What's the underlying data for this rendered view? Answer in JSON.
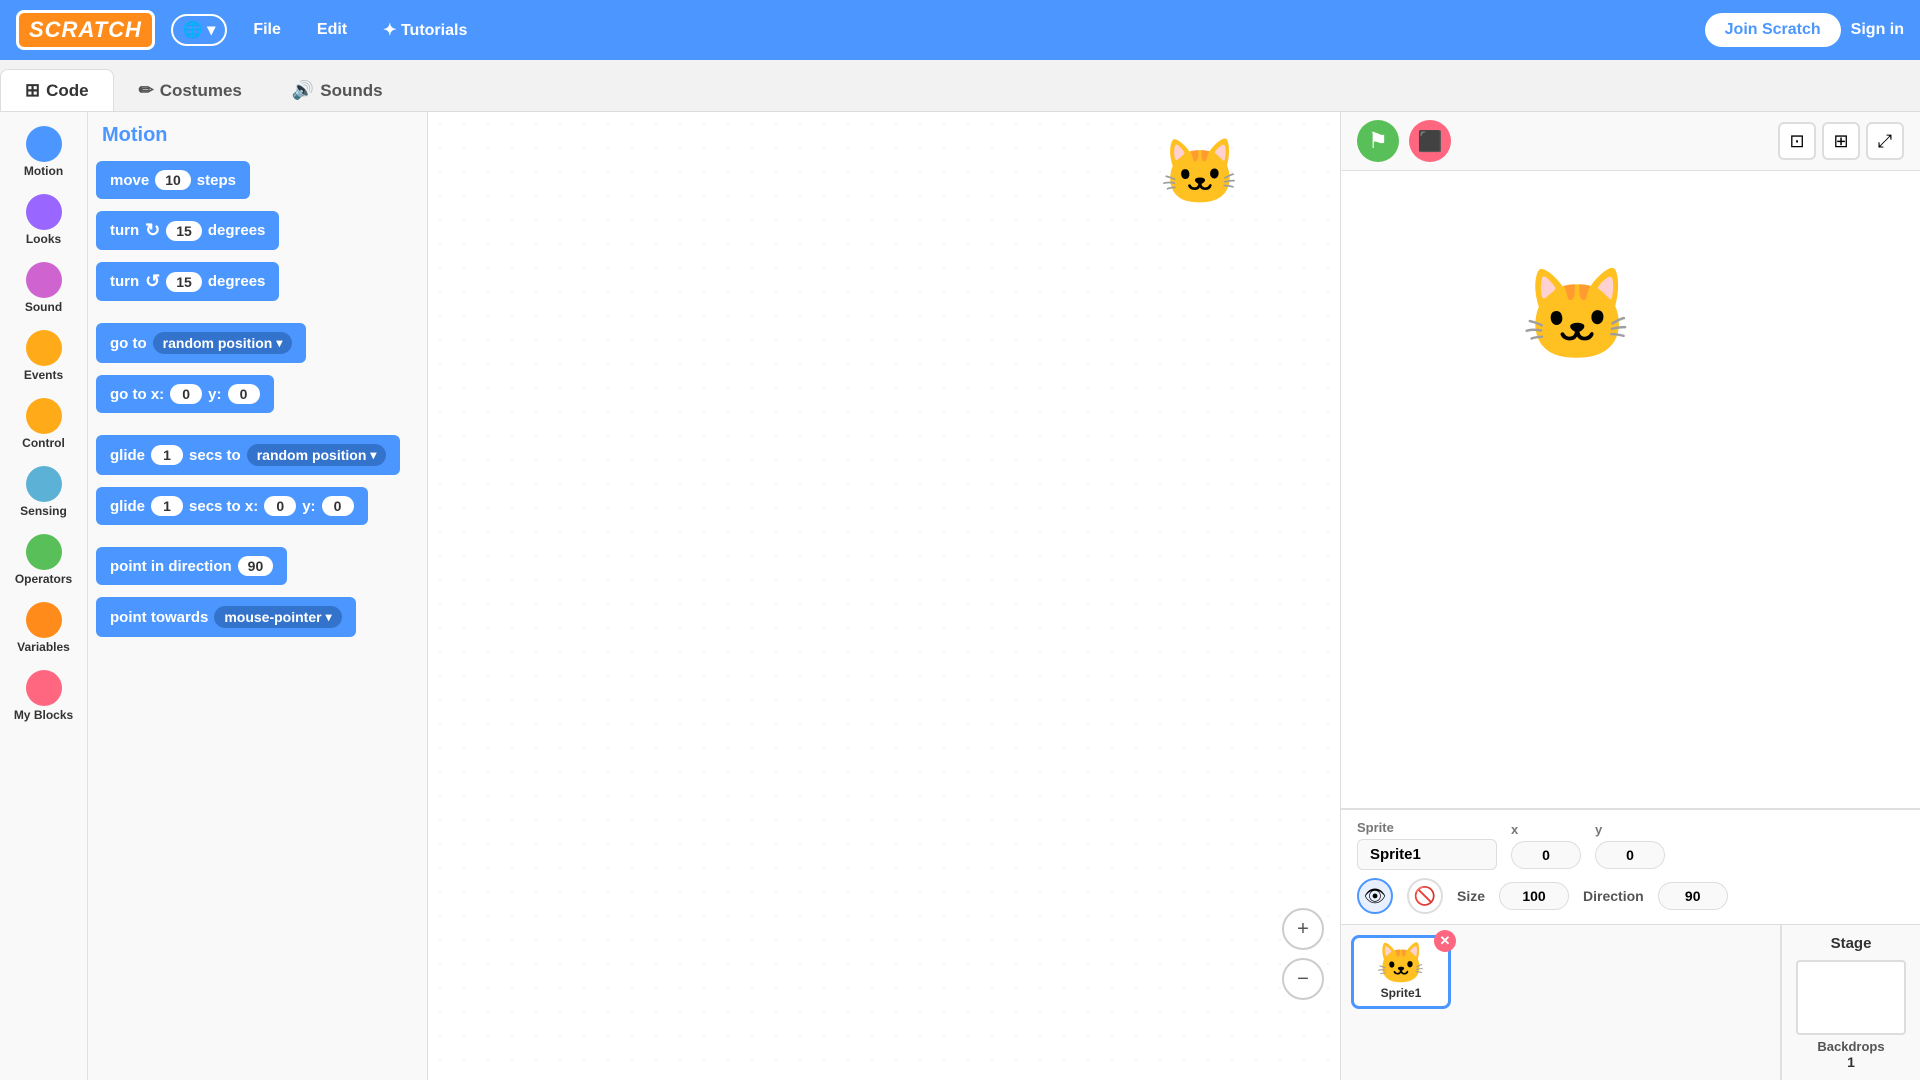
{
  "header": {
    "logo": "SCRATCH",
    "globe_label": "🌐 ▾",
    "file_label": "File",
    "edit_label": "Edit",
    "tutorials_label": "✦ Tutorials",
    "join_label": "Join Scratch",
    "signin_label": "Sign in"
  },
  "tabs": {
    "code_label": "Code",
    "costumes_label": "Costumes",
    "sounds_label": "Sounds"
  },
  "categories": [
    {
      "id": "motion",
      "label": "Motion",
      "color": "#4C97FF"
    },
    {
      "id": "looks",
      "label": "Looks",
      "color": "#9966FF"
    },
    {
      "id": "sound",
      "label": "Sound",
      "color": "#CF63CF"
    },
    {
      "id": "events",
      "label": "Events",
      "color": "#FFAB19"
    },
    {
      "id": "control",
      "label": "Control",
      "color": "#FFAB19"
    },
    {
      "id": "sensing",
      "label": "Sensing",
      "color": "#5CB1D6"
    },
    {
      "id": "operators",
      "label": "Operators",
      "color": "#59C059"
    },
    {
      "id": "variables",
      "label": "Variables",
      "color": "#FF8C1A"
    },
    {
      "id": "myblocks",
      "label": "My Blocks",
      "color": "#FF6680"
    }
  ],
  "blocks_panel": {
    "title": "Motion",
    "blocks": [
      {
        "id": "move",
        "label": "move",
        "value": "10",
        "suffix": "steps"
      },
      {
        "id": "turn_cw",
        "label": "turn",
        "icon": "↻",
        "value": "15",
        "suffix": "degrees"
      },
      {
        "id": "turn_ccw",
        "label": "turn",
        "icon": "↺",
        "value": "15",
        "suffix": "degrees"
      },
      {
        "id": "goto",
        "label": "go to",
        "dropdown": "random position"
      },
      {
        "id": "goto_xy",
        "label": "go to x:",
        "x": "0",
        "y_label": "y:",
        "y": "0"
      },
      {
        "id": "glide1",
        "label": "glide",
        "value": "1",
        "mid": "secs to",
        "dropdown": "random position"
      },
      {
        "id": "glide2",
        "label": "glide",
        "value": "1",
        "mid": "secs to x:",
        "x": "0",
        "y_label": "y:",
        "y": "0"
      },
      {
        "id": "point_dir",
        "label": "point in direction",
        "value": "90"
      },
      {
        "id": "point_towards",
        "label": "point towards",
        "dropdown": "mouse-pointer"
      }
    ]
  },
  "sprite": {
    "label": "Sprite",
    "name": "Sprite1",
    "x_label": "x",
    "x_val": "0",
    "y_label": "y",
    "y_val": "0",
    "size_label": "Size",
    "size_val": "100",
    "direction_label": "Direction",
    "direction_val": "90",
    "show_icon": "👁",
    "hide_icon": "🚫"
  },
  "stage": {
    "title": "Stage",
    "backdrops_label": "Backdrops",
    "backdrops_count": "1"
  },
  "sprite_thumb": {
    "name": "Sprite1",
    "emoji": "🐱"
  },
  "zoom_in": "+",
  "zoom_out": "−",
  "green_flag": "⚑",
  "red_stop": "⬛"
}
